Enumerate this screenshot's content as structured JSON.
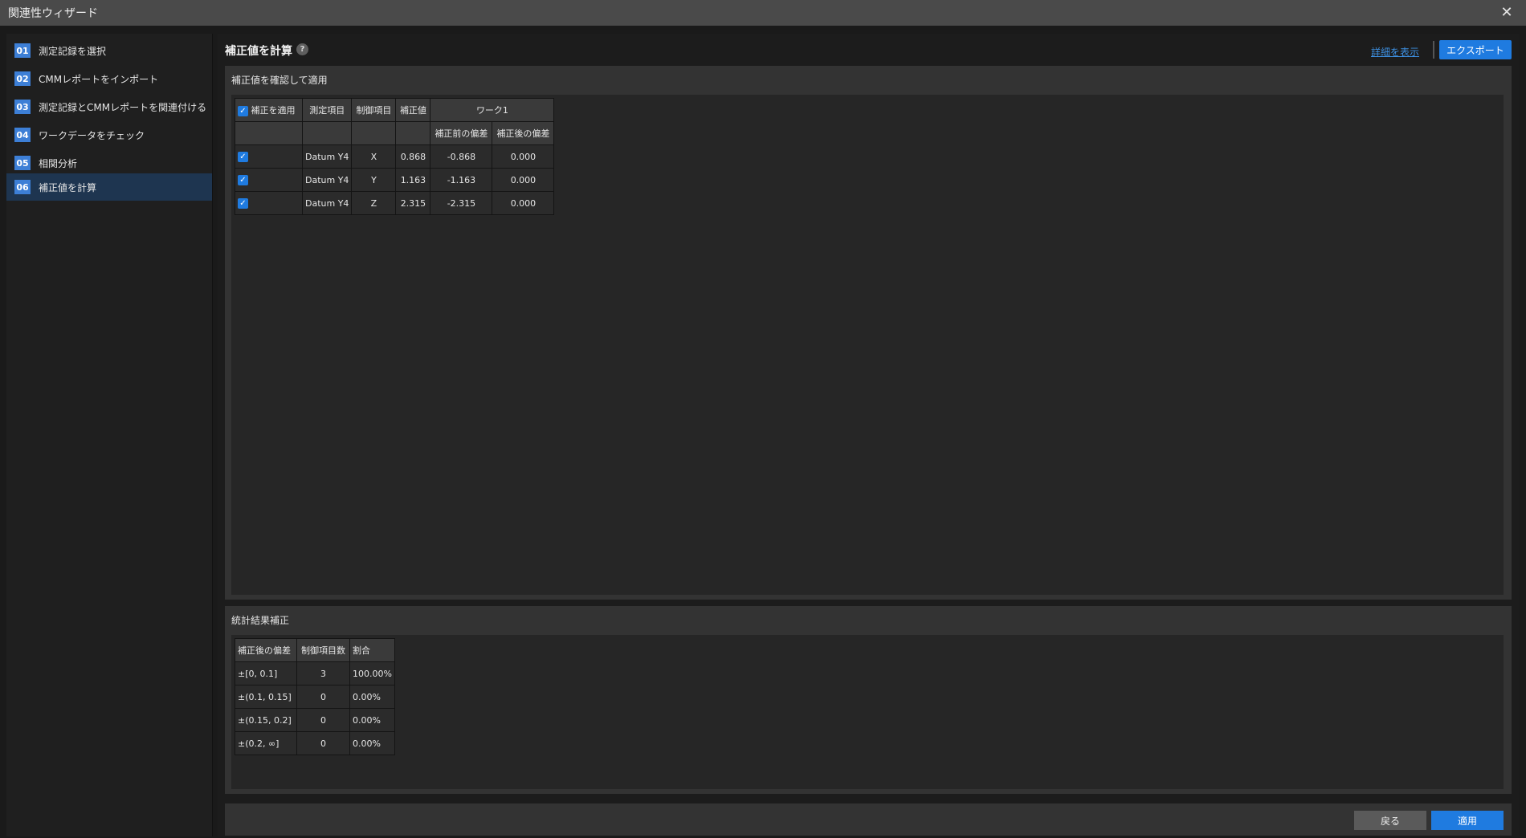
{
  "window": {
    "title": "関連性ウィザード"
  },
  "steps": [
    {
      "num": "01",
      "label": "測定記録を選択"
    },
    {
      "num": "02",
      "label": "CMMレポートをインポート"
    },
    {
      "num": "03",
      "label": "測定記録とCMMレポートを関連付ける"
    },
    {
      "num": "04",
      "label": "ワークデータをチェック"
    },
    {
      "num": "05",
      "label": "相関分析"
    },
    {
      "num": "06",
      "label": "補正値を計算"
    }
  ],
  "active_step": "06",
  "header": {
    "title": "補正値を計算",
    "help": "?",
    "details_link": "詳細を表示",
    "export_label": "エクスポート"
  },
  "correction_panel": {
    "title": "補正値を確認して適用",
    "columns": {
      "apply": "補正を適用",
      "measure_item": "測定項目",
      "control_item": "制御項目",
      "correction": "補正値",
      "work": "ワーク1",
      "before": "補正前の偏差",
      "after": "補正後の偏差"
    },
    "rows": [
      {
        "checked": true,
        "measure_item": "Datum Y4",
        "control_item": "X",
        "correction": "0.868",
        "before": "-0.868",
        "after": "0.000"
      },
      {
        "checked": true,
        "measure_item": "Datum Y4",
        "control_item": "Y",
        "correction": "1.163",
        "before": "-1.163",
        "after": "0.000"
      },
      {
        "checked": true,
        "measure_item": "Datum Y4",
        "control_item": "Z",
        "correction": "2.315",
        "before": "-2.315",
        "after": "0.000"
      }
    ]
  },
  "stats_panel": {
    "title": "統計結果補正",
    "columns": {
      "range": "補正後の偏差",
      "count": "制御項目数",
      "ratio": "割合"
    },
    "rows": [
      {
        "range": "±[0, 0.1]",
        "count": "3",
        "ratio": "100.00%"
      },
      {
        "range": "±(0.1, 0.15]",
        "count": "0",
        "ratio": "0.00%"
      },
      {
        "range": "±(0.15, 0.2]",
        "count": "0",
        "ratio": "0.00%"
      },
      {
        "range": "±(0.2, ∞]",
        "count": "0",
        "ratio": "0.00%"
      }
    ]
  },
  "footer": {
    "back_label": "戻る",
    "apply_label": "適用"
  },
  "colors": {
    "accent": "#1f7be0",
    "active_step_bg": "#1e3550",
    "link": "#3d8fe0"
  }
}
